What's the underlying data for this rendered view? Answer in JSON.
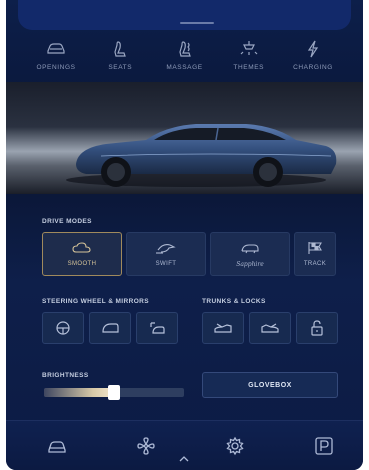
{
  "categories": [
    {
      "label": "OPENINGS",
      "icon": "car-top-icon"
    },
    {
      "label": "SEATS",
      "icon": "seat-icon"
    },
    {
      "label": "MASSAGE",
      "icon": "massage-icon"
    },
    {
      "label": "THEMES",
      "icon": "lamp-icon"
    },
    {
      "label": "CHARGING",
      "icon": "bolt-icon"
    }
  ],
  "drive_modes": {
    "title": "DRIVE MODES",
    "modes": [
      {
        "label": "SMOOTH",
        "icon": "cloud-icon",
        "active": true
      },
      {
        "label": "SWIFT",
        "icon": "swift-icon",
        "active": false
      },
      {
        "label": "Sapphire",
        "icon": "sapphire-icon",
        "active": false
      },
      {
        "label": "TRACK",
        "icon": "track-flag-icon",
        "active": false
      }
    ]
  },
  "steering": {
    "title": "STEERING WHEEL & MIRRORS",
    "buttons": [
      "steering-wheel-icon",
      "mirror-icon",
      "mirror-adjust-icon"
    ]
  },
  "trunks": {
    "title": "TRUNKS & LOCKS",
    "buttons": [
      "front-trunk-icon",
      "rear-trunk-icon",
      "lock-icon"
    ]
  },
  "brightness": {
    "title": "BRIGHTNESS",
    "level": 0.5
  },
  "glovebox": {
    "label": "GLOVEBOX"
  },
  "bottom_nav": [
    "car-icon",
    "fan-icon",
    "settings-gear-icon",
    "parking-icon"
  ],
  "colors": {
    "accent_gold": "#a08a5c",
    "background": "#0b1a40"
  }
}
